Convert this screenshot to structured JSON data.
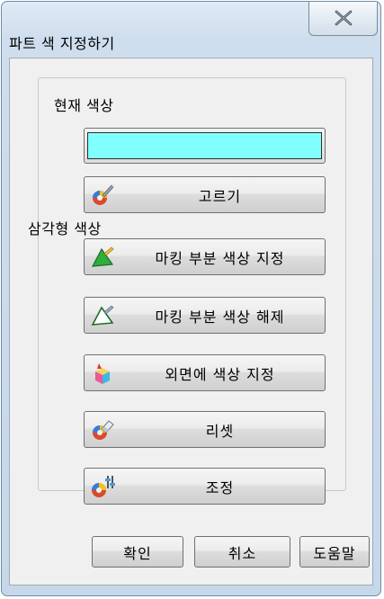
{
  "window": {
    "title": "파트 색 지정하기"
  },
  "current_color": {
    "label": "현재 색상",
    "value": "#80ffff",
    "pick_label": "고르기"
  },
  "triangle_color": {
    "label": "삼각형 색상",
    "buttons": {
      "mark_set": "마킹 부분 색상 지정",
      "mark_clear": "마킹 부분 색상 해제",
      "outer_set": "외면에 색상 지정",
      "reset": "리셋",
      "adjust": "조정"
    }
  },
  "footer": {
    "ok": "확인",
    "cancel": "취소",
    "help": "도움말"
  },
  "icons": [
    "close-icon",
    "palette-brush-icon",
    "triangle-fill-icon",
    "triangle-outline-icon",
    "cube-paint-icon",
    "eraser-icon",
    "sliders-icon"
  ]
}
